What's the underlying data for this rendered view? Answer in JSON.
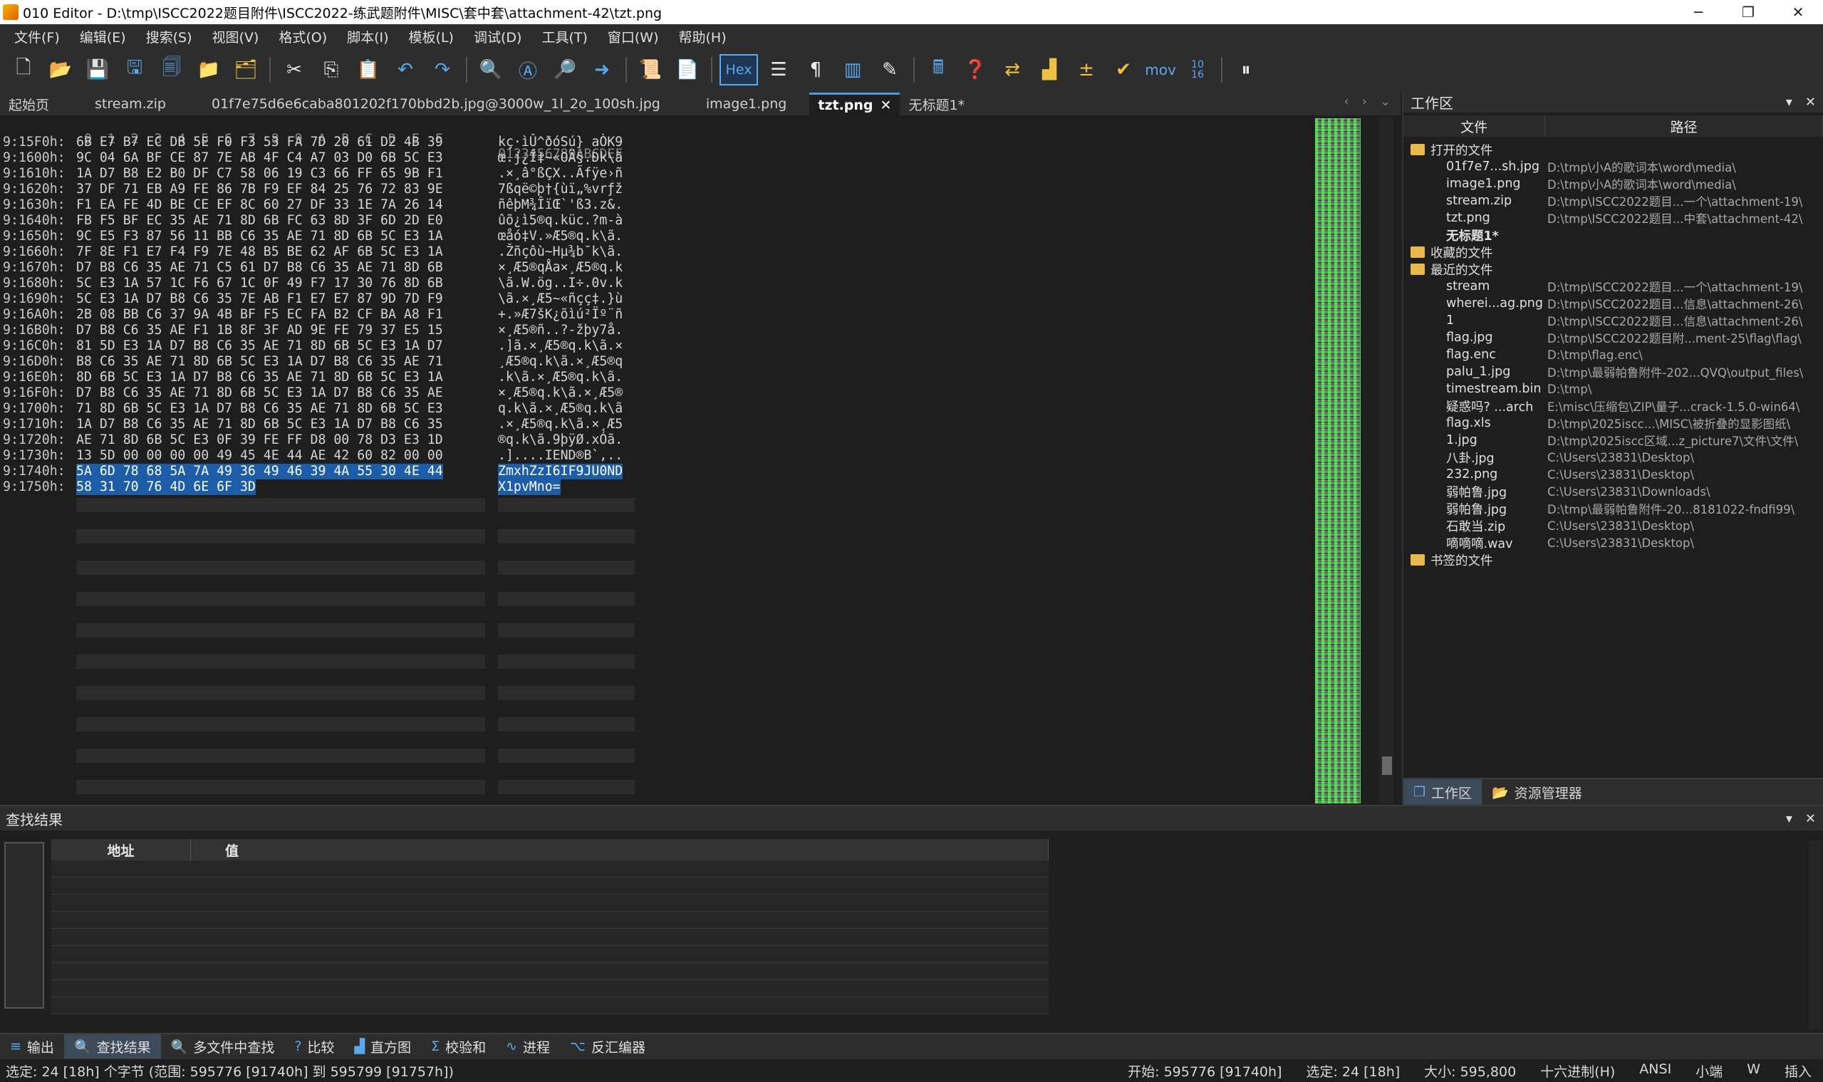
{
  "window": {
    "title": "010 Editor - D:\\tmp\\ISCC2022题目附件\\ISCC2022-练武题附件\\MISC\\套中套\\attachment-42\\tzt.png",
    "minimize": "─",
    "maximize": "❐",
    "close": "✕"
  },
  "menu": [
    "文件(F)",
    "编辑(E)",
    "搜索(S)",
    "视图(V)",
    "格式(O)",
    "脚本(I)",
    "模板(L)",
    "调试(D)",
    "工具(T)",
    "窗口(W)",
    "帮助(H)"
  ],
  "toolbar": {
    "hex_label": "Hex",
    "mov_label": "mov",
    "convert_label": "10\n16"
  },
  "tabs": [
    {
      "label": "起始页"
    },
    {
      "label": "stream.zip"
    },
    {
      "label": "01f7e75d6e6caba801202f170bbd2b.jpg@3000w_1l_2o_100sh.jpg"
    },
    {
      "label": "image1.png"
    },
    {
      "label": "tzt.png",
      "active": true
    },
    {
      "label": "无标题1*"
    }
  ],
  "hex": {
    "header_bytes": " 0  1  2  3  4  5  6  7  8  9  A  B  C  D  E  F",
    "header_ascii": "0123456789ABCDEF",
    "rows": [
      {
        "addr": "9:15F0h:",
        "bytes": "6B E7 B7 EC DB 5E F0 F3 53 FA 7D 20 61 D2 4B 39",
        "ascii": "kç·ìÛ^ðóSú} aÒK9"
      },
      {
        "addr": "9:1600h:",
        "bytes": "9C 04 6A BF CE 87 7E AB 4F C4 A7 03 D0 6B 5C E3",
        "ascii": "œ.j¿Î‡~«OÄ§.Ðk\\ã"
      },
      {
        "addr": "9:1610h:",
        "bytes": "1A D7 B8 E2 B0 DF C7 58 06 19 C3 66 FF 65 9B F1",
        "ascii": ".×¸â°ßÇX..Ãfÿe›ñ"
      },
      {
        "addr": "9:1620h:",
        "bytes": "37 DF 71 EB A9 FE 86 7B F9 EF 84 25 76 72 83 9E",
        "ascii": "7ßqë©þ†{ùï„%vrƒž"
      },
      {
        "addr": "9:1630h:",
        "bytes": "F1 EA FE 4D BE CE EF 8C 60 27 DF 33 1E 7A 26 14",
        "ascii": "ñêþM¾ÎïŒ`'ß3.z&."
      },
      {
        "addr": "9:1640h:",
        "bytes": "FB F5 BF EC 35 AE 71 8D 6B FC 63 8D 3F 6D 2D E0",
        "ascii": "ûõ¿ì5®q.küc.?m-à"
      },
      {
        "addr": "9:1650h:",
        "bytes": "9C E5 F3 87 56 11 BB C6 35 AE 71 8D 6B 5C E3 1A",
        "ascii": "œåó‡V.»Æ5®q.k\\ã."
      },
      {
        "addr": "9:1660h:",
        "bytes": "7F 8E F1 E7 F4 F9 7E 48 B5 BE 62 AF 6B 5C E3 1A",
        "ascii": ".Žñçôù~Hµ¾b¯k\\ã."
      },
      {
        "addr": "9:1670h:",
        "bytes": "D7 B8 C6 35 AE 71 C5 61 D7 B8 C6 35 AE 71 8D 6B",
        "ascii": "×¸Æ5®qÅa×¸Æ5®q.k"
      },
      {
        "addr": "9:1680h:",
        "bytes": "5C E3 1A 57 1C F6 67 1C 0F 49 F7 17 30 76 8D 6B",
        "ascii": "\\ã.W.ög..I÷.0v.k"
      },
      {
        "addr": "9:1690h:",
        "bytes": "5C E3 1A D7 B8 C6 35 7E AB F1 E7 E7 87 9D 7D F9",
        "ascii": "\\ã.×¸Æ5~«ñçç‡.}ù"
      },
      {
        "addr": "9:16A0h:",
        "bytes": "2B 08 BB C6 37 9A 4B BF F5 EC FA B2 CF BA A8 F1",
        "ascii": "+.»Æ7šK¿õìú²Ïº¨ñ"
      },
      {
        "addr": "9:16B0h:",
        "bytes": "D7 B8 C6 35 AE F1 1B 8F 3F AD 9E FE 79 37 E5 15",
        "ascii": "×¸Æ5®ñ..?-žþy7å."
      },
      {
        "addr": "9:16C0h:",
        "bytes": "81 5D E3 1A D7 B8 C6 35 AE 71 8D 6B 5C E3 1A D7",
        "ascii": ".]ã.×¸Æ5®q.k\\ã.×"
      },
      {
        "addr": "9:16D0h:",
        "bytes": "B8 C6 35 AE 71 8D 6B 5C E3 1A D7 B8 C6 35 AE 71",
        "ascii": "¸Æ5®q.k\\ã.×¸Æ5®q"
      },
      {
        "addr": "9:16E0h:",
        "bytes": "8D 6B 5C E3 1A D7 B8 C6 35 AE 71 8D 6B 5C E3 1A",
        "ascii": ".k\\ã.×¸Æ5®q.k\\ã."
      },
      {
        "addr": "9:16F0h:",
        "bytes": "D7 B8 C6 35 AE 71 8D 6B 5C E3 1A D7 B8 C6 35 AE",
        "ascii": "×¸Æ5®q.k\\ã.×¸Æ5®"
      },
      {
        "addr": "9:1700h:",
        "bytes": "71 8D 6B 5C E3 1A D7 B8 C6 35 AE 71 8D 6B 5C E3",
        "ascii": "q.k\\ã.×¸Æ5®q.k\\ã"
      },
      {
        "addr": "9:1710h:",
        "bytes": "1A D7 B8 C6 35 AE 71 8D 6B 5C E3 1A D7 B8 C6 35",
        "ascii": ".×¸Æ5®q.k\\ã.×¸Æ5"
      },
      {
        "addr": "9:1720h:",
        "bytes": "AE 71 8D 6B 5C E3 0F 39 FE FF D8 00 78 D3 E3 1D",
        "ascii": "®q.k\\ã.9þÿØ.xÓã."
      },
      {
        "addr": "9:1730h:",
        "bytes": "13 5D 00 00 00 00 49 45 4E 44 AE 42 60 82 00 00",
        "ascii": ".]....IEND®B`‚.."
      },
      {
        "addr": "9:1740h:",
        "bytes": "5A 6D 78 68 5A 7A 49 36 49 46 39 4A 55 30 4E 44",
        "ascii": "ZmxhZzI6IF9JU0ND",
        "selected": true
      },
      {
        "addr": "9:1750h:",
        "bytes": "58 31 70 76 4D 6E 6F 3D",
        "ascii": "X1pvMno=",
        "selected": true
      }
    ]
  },
  "workspace": {
    "title": "工作区",
    "col_file": "文件",
    "col_path": "路径",
    "open_group": "打开的文件",
    "open_files": [
      {
        "name": "01f7e7...sh.jpg",
        "path": "D:\\tmp\\小A的歌词本\\word\\media\\"
      },
      {
        "name": "image1.png",
        "path": "D:\\tmp\\小A的歌词本\\word\\media\\"
      },
      {
        "name": "stream.zip",
        "path": "D:\\tmp\\ISCC2022题目...一个\\attachment-19\\"
      },
      {
        "name": "tzt.png",
        "path": "D:\\tmp\\ISCC2022题目...中套\\attachment-42\\"
      },
      {
        "name": "无标题1*",
        "path": ""
      }
    ],
    "fav_group": "收藏的文件",
    "recent_group": "最近的文件",
    "recent_files": [
      {
        "name": "stream",
        "path": "D:\\tmp\\ISCC2022题目...一个\\attachment-19\\"
      },
      {
        "name": "wherei...ag.png",
        "path": "D:\\tmp\\ISCC2022题目...信息\\attachment-26\\"
      },
      {
        "name": "1",
        "path": "D:\\tmp\\ISCC2022题目...信息\\attachment-26\\"
      },
      {
        "name": "flag.jpg",
        "path": "D:\\tmp\\ISCC2022题目附...ment-25\\flag\\flag\\"
      },
      {
        "name": "flag.enc",
        "path": "D:\\tmp\\flag.enc\\"
      },
      {
        "name": "palu_1.jpg",
        "path": "D:\\tmp\\最弱帕鲁附件-202...QVQ\\output_files\\"
      },
      {
        "name": "timestream.bin",
        "path": "D:\\tmp\\"
      },
      {
        "name": "疑惑吗? ...arch",
        "path": "E:\\misc\\压缩包\\ZIP\\量子...crack-1.5.0-win64\\"
      },
      {
        "name": "flag.xls",
        "path": "D:\\tmp\\2025iscc...\\MISC\\被折叠的显影图纸\\"
      },
      {
        "name": "1.jpg",
        "path": "D:\\tmp\\2025iscc区域...z_picture7\\文件\\文件\\"
      },
      {
        "name": "八卦.jpg",
        "path": "C:\\Users\\23831\\Desktop\\"
      },
      {
        "name": "232.png",
        "path": "C:\\Users\\23831\\Desktop\\"
      },
      {
        "name": "弱帕鲁.jpg",
        "path": "C:\\Users\\23831\\Downloads\\"
      },
      {
        "name": "弱帕鲁.jpg",
        "path": "D:\\tmp\\最弱帕鲁附件-20...8181022-fndfi99\\"
      },
      {
        "name": "石敢当.zip",
        "path": "C:\\Users\\23831\\Desktop\\"
      },
      {
        "name": "嘀嘀嘀.wav",
        "path": "C:\\Users\\23831\\Desktop\\"
      }
    ],
    "bookmark_group": "书签的文件",
    "bottom_tabs": [
      "工作区",
      "资源管理器"
    ]
  },
  "find": {
    "title": "查找结果",
    "col_addr": "地址",
    "col_value": "值"
  },
  "bottom_tabs": [
    {
      "label": "输出",
      "icon": "≡"
    },
    {
      "label": "查找结果",
      "icon": "🔍",
      "active": true
    },
    {
      "label": "多文件中查找",
      "icon": "🔍"
    },
    {
      "label": "比较",
      "icon": "?"
    },
    {
      "label": "直方图",
      "icon": "▟"
    },
    {
      "label": "校验和",
      "icon": "Σ"
    },
    {
      "label": "进程",
      "icon": "∿"
    },
    {
      "label": "反汇编器",
      "icon": "⌥"
    }
  ],
  "status": {
    "left": "选定: 24 [18h] 个字节 (范围: 595776 [91740h] 到 595799 [91757h])",
    "start": "开始: 595776 [91740h]",
    "selected": "选定: 24 [18h]",
    "size": "大小: 595,800",
    "mode": "十六进制(H)",
    "encoding": "ANSI",
    "endian": "小端",
    "w": "W",
    "insert": "插入"
  }
}
